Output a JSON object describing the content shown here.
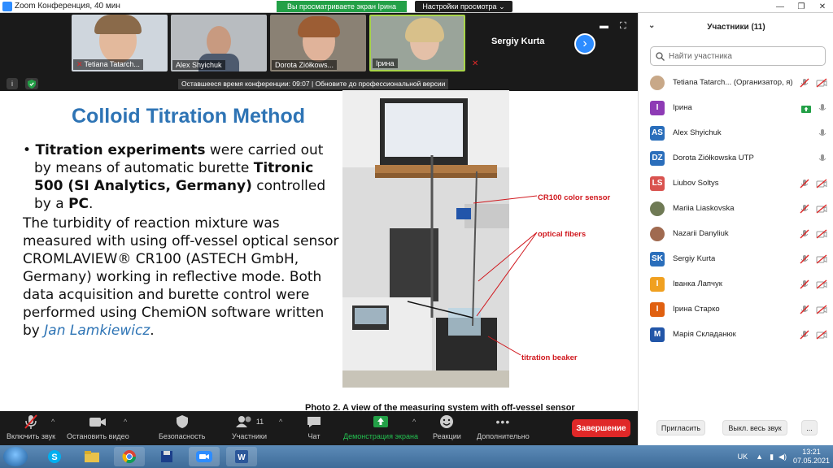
{
  "window": {
    "title": "Zoom Конференция, 40 мин",
    "share_banner": "Вы просматриваете экран Ірина",
    "view_options": "Настройки просмотра"
  },
  "video_strip": {
    "tiles": [
      {
        "name": "Tetiana Tatarch...",
        "muted": true,
        "bg": "#cfd6dd"
      },
      {
        "name": "Alex Shyichuk",
        "muted": false,
        "bg": "#b8bcc0"
      },
      {
        "name": "Dorota Ziółkows...",
        "muted": true,
        "bg": "#8a8174"
      },
      {
        "name": "Ірина",
        "muted": false,
        "bg": "#9aa49a"
      }
    ],
    "text_only_name": "Sergiy Kurta"
  },
  "stage": {
    "time_banner": "Оставшееся время конференции: 09:07 | Обновите до профессиональной версии"
  },
  "slide": {
    "title": "Colloid Titration Method",
    "bullet": {
      "b1": "Titration experiments",
      "t1": " were carried out by means of automatic burette ",
      "b2": "Titronic 500 (SI Analytics, Germany)",
      "t2": " controlled by a ",
      "b3": "PC",
      "t3": "."
    },
    "paragraph": {
      "text": "The turbidity of reaction mixture was measured with using off-vessel optical sensor CROMLAVIEW® CR100 (ASTECH GmbH, Germany) working in reflective mode. Both data acquisition and burette control were performed using ChemiON software written by ",
      "author": "Jan Lamkiewicz",
      "end": "."
    },
    "photo_labels": {
      "sensor": "CR100 color sensor",
      "fibers": "optical fibers",
      "beaker": "titration beaker"
    },
    "caption": "Photo 2. A view of the measuring system with off-vessel sensor"
  },
  "toolbar": {
    "mute": "Включить звук",
    "video": "Остановить видео",
    "security": "Безопасность",
    "participants": "Участники",
    "participants_count": "11",
    "chat": "Чат",
    "share": "Демонстрация экрана",
    "reactions": "Реакции",
    "more": "Дополнительно",
    "end": "Завершение"
  },
  "panel": {
    "title": "Участники (11)",
    "search_placeholder": "Найти участника",
    "participants": [
      {
        "name": "Tetiana Tatarch... (Организатор, я)",
        "initials": "",
        "color": "#c8a888",
        "photo": true
      },
      {
        "name": "Ірина",
        "initials": "І",
        "color": "#8e3bb5",
        "photo": false
      },
      {
        "name": "Alex Shyichuk",
        "initials": "AS",
        "color": "#2a6ebb",
        "photo": false
      },
      {
        "name": "Dorota Ziółkowska UTP",
        "initials": "DZ",
        "color": "#2a6ebb",
        "photo": false
      },
      {
        "name": "Liubov Soltys",
        "initials": "LS",
        "color": "#d9534f",
        "photo": false
      },
      {
        "name": "Mariia Liaskovska",
        "initials": "",
        "color": "#6f7a55",
        "photo": true
      },
      {
        "name": "Nazarii Danyliuk",
        "initials": "",
        "color": "#a06a50",
        "photo": true
      },
      {
        "name": "Sergiy Kurta",
        "initials": "SK",
        "color": "#2a6ebb",
        "photo": false
      },
      {
        "name": "Іванка Лапчук",
        "initials": "І",
        "color": "#f0a020",
        "photo": false
      },
      {
        "name": "Ірина Старко",
        "initials": "І",
        "color": "#e06010",
        "photo": false
      },
      {
        "name": "Марія Складанюк",
        "initials": "M",
        "color": "#2256a8",
        "photo": false
      }
    ],
    "invite": "Пригласить",
    "mute_all": "Выкл. весь звук",
    "more": "..."
  },
  "taskbar": {
    "lang": "UK",
    "time": "13:21",
    "date": "07.05.2021"
  }
}
